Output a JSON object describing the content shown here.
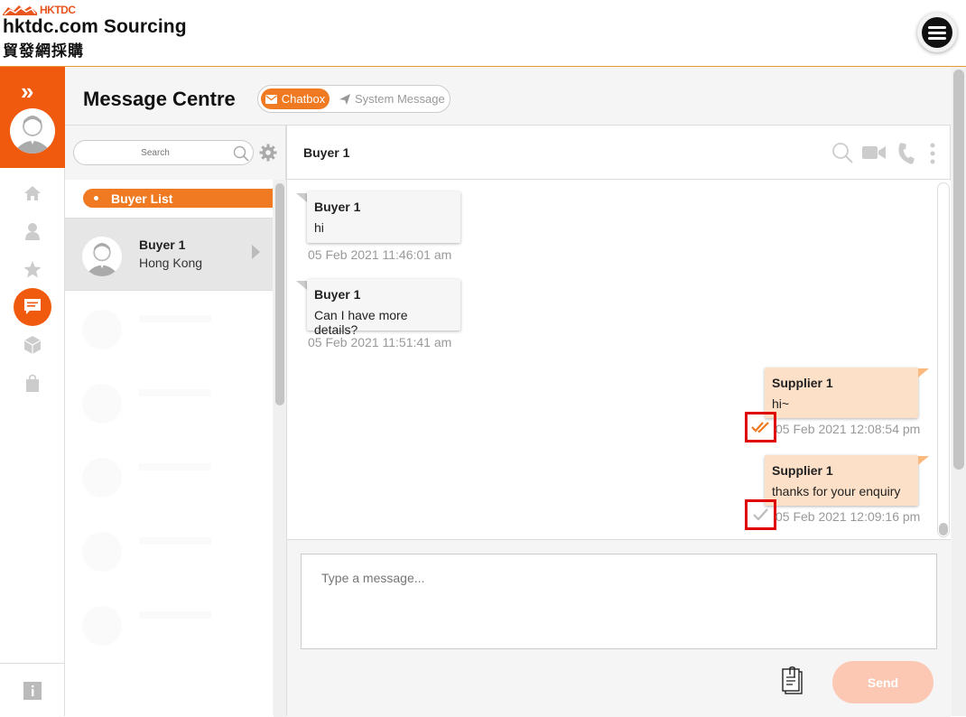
{
  "header": {
    "logo_text": "HKTDC",
    "brand_en": "hktdc.com Sourcing",
    "brand_zh": "貿發網採購",
    "menu_icon": "hamburger-icon"
  },
  "rail": {
    "expand_glyph": "»",
    "items": [
      "home-icon",
      "user-icon",
      "star-icon",
      "chat-icon",
      "cube-icon",
      "bag-icon"
    ],
    "active": "chat-icon",
    "info_icon": "info-icon"
  },
  "page": {
    "title": "Message Centre",
    "tabs": [
      {
        "label": "Chatbox",
        "icon": "mail-icon",
        "active": true
      },
      {
        "label": "System Message",
        "icon": "send-icon",
        "active": false
      }
    ]
  },
  "search": {
    "placeholder": "Search"
  },
  "buyer_list": {
    "label": "Buyer List",
    "contacts": [
      {
        "name": "Buyer 1",
        "location": "Hong Kong"
      }
    ]
  },
  "chat": {
    "title": "Buyer 1",
    "header_icons": [
      "search-icon",
      "video-icon",
      "phone-icon",
      "more-icon"
    ],
    "messages": [
      {
        "direction": "in",
        "sender": "Buyer 1",
        "text": "hi",
        "time": "05 Feb 2021 11:46:01 am"
      },
      {
        "direction": "in",
        "sender": "Buyer 1",
        "text": "Can I have more details?",
        "time": "05 Feb 2021 11:51:41 am"
      },
      {
        "direction": "out",
        "sender": "Supplier 1",
        "text": "hi~",
        "time": "05 Feb 2021 12:08:54 pm",
        "status": "read"
      },
      {
        "direction": "out",
        "sender": "Supplier 1",
        "text": "thanks for your enquiry",
        "time": "05 Feb 2021 12:09:16 pm",
        "status": "sent"
      }
    ]
  },
  "composer": {
    "placeholder": "Type a message...",
    "send_label": "Send"
  },
  "colors": {
    "brand": "#f05a0f",
    "accent": "#f07a21",
    "outgoing_bubble": "#fde0c8",
    "read_tick": "#f07a21",
    "highlight": "#e00000"
  }
}
